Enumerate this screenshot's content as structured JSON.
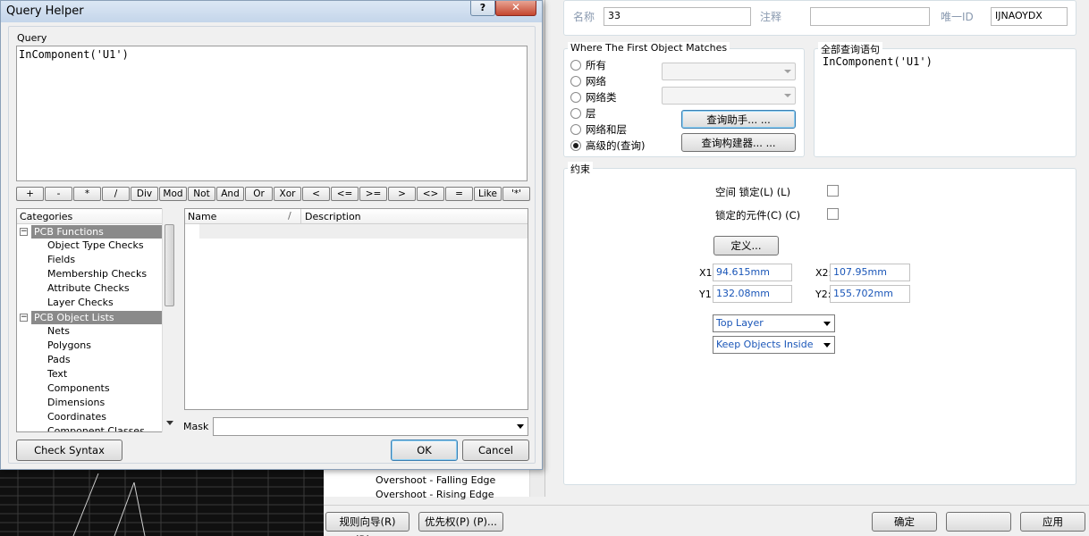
{
  "query_helper": {
    "title": "Query Helper",
    "help_glyph": "?",
    "close_glyph": "✕",
    "query_label": "Query",
    "query_text": "InComponent('U1')",
    "operators": [
      "+",
      "-",
      "*",
      "/",
      "Div",
      "Mod",
      "Not",
      "And",
      "Or",
      "Xor",
      "<",
      "<=",
      ">=",
      ">",
      "<>",
      "=",
      "Like",
      "'*'"
    ],
    "categories_header": "Categories",
    "name_header": "Name",
    "description_header": "Description",
    "categories": [
      {
        "label": "PCB Functions",
        "group": true
      },
      {
        "label": "Object Type Checks"
      },
      {
        "label": "Fields"
      },
      {
        "label": "Membership Checks"
      },
      {
        "label": "Attribute Checks"
      },
      {
        "label": "Layer Checks"
      },
      {
        "label": "PCB Object Lists",
        "group": true
      },
      {
        "label": "Nets"
      },
      {
        "label": "Polygons"
      },
      {
        "label": "Pads"
      },
      {
        "label": "Text"
      },
      {
        "label": "Components"
      },
      {
        "label": "Dimensions"
      },
      {
        "label": "Coordinates"
      },
      {
        "label": "Component Classes"
      }
    ],
    "mask_label": "Mask",
    "check_syntax": "Check Syntax",
    "ok": "OK",
    "cancel": "Cancel"
  },
  "rule": {
    "name_label": "名称",
    "name_value": "33",
    "comment_label": "注释",
    "comment_value": "",
    "uid_label": "唯一ID",
    "uid_value": "IJNAOYDX"
  },
  "scope": {
    "title": "Where The First Object Matches",
    "options": [
      "所有",
      "网络",
      "网络类",
      "层",
      "网络和层",
      "高级的(查询)"
    ],
    "selected_index": 5,
    "query_helper_button": "查询助手... ...",
    "query_builder_button": "查询构建器... ...",
    "full_query_title": "全部查询语句",
    "full_query_text": "InComponent('U1')"
  },
  "constraints": {
    "title": "约束",
    "room_locked_label": "空间 锁定(L) (L)",
    "components_locked_label": "锁定的元件(C) (C)",
    "define_button": "定义...",
    "x1_label": "X1:",
    "x1_value": "94.615mm",
    "y1_label": "Y1:",
    "y1_value": "132.08mm",
    "x2_label": "X2:",
    "x2_value": "107.95mm",
    "y2_label": "Y2:",
    "y2_value": "155.702mm",
    "layer_value": "Top Layer",
    "kind_value": "Keep Objects Inside"
  },
  "tree": {
    "row1": "Overshoot - Falling Edge",
    "row2": "Overshoot - Rising Edge"
  },
  "bottom": {
    "rule_wizard": "规则向导(R) (R)...",
    "priorities": "优先权(P) (P)...",
    "ok": "确定",
    "apply": "应用"
  }
}
